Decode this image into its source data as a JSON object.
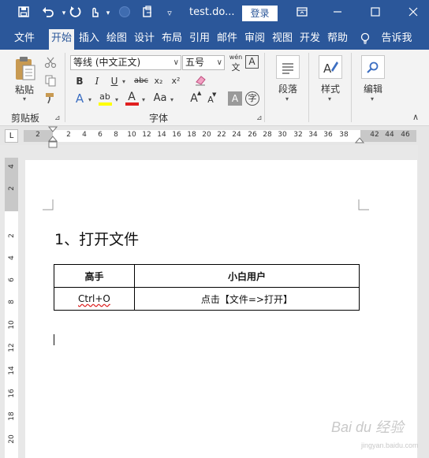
{
  "window": {
    "title": "test.do...",
    "login_label": "登录",
    "quick_access": [
      "save-icon",
      "undo-icon",
      "redo-icon",
      "touch-mode-icon",
      "circle-icon",
      "clipboard-icon",
      "customize-icon"
    ],
    "controls": [
      "ribbon-display-icon",
      "minimize-icon",
      "maximize-icon",
      "close-icon"
    ]
  },
  "tabs": [
    "文件",
    "开始",
    "插入",
    "绘图",
    "设计",
    "布局",
    "引用",
    "邮件",
    "审阅",
    "视图",
    "开发",
    "帮助",
    "告诉我"
  ],
  "active_tab": "开始",
  "ribbon": {
    "clipboard": {
      "paste_label": "粘贴",
      "group_label": "剪贴板"
    },
    "font": {
      "font_name": "等线 (中文正文)",
      "font_size": "五号",
      "phonetic_label": "wén",
      "border_char_label": "A",
      "bold": "B",
      "italic": "I",
      "underline": "U",
      "strike": "abc",
      "subscript": "x₂",
      "superscript": "x²",
      "text_effect": "A",
      "highlight": "ab",
      "font_color": "A",
      "change_case": "Aa",
      "grow_font": "A",
      "shrink_font": "A",
      "char_shading": "A",
      "enclose_char": "字",
      "group_label": "字体"
    },
    "paragraph_label": "段落",
    "styles_label": "样式",
    "editing_label": "编辑"
  },
  "ruler": {
    "tab_selector": "L",
    "h_ticks": [
      "2",
      "2",
      "4",
      "6",
      "8",
      "10",
      "12",
      "14",
      "16",
      "18",
      "20",
      "22",
      "24",
      "26",
      "28",
      "30",
      "32",
      "34",
      "36",
      "38",
      "42",
      "44",
      "46"
    ],
    "v_ticks": [
      "4",
      "2",
      "2",
      "4",
      "6",
      "8",
      "10",
      "12",
      "14",
      "16",
      "18",
      "20"
    ]
  },
  "document": {
    "heading": "1、打开文件",
    "table": {
      "headers": [
        "高手",
        "小白用户"
      ],
      "rows": [
        [
          "Ctrl+O",
          "点击【文件=>打开】"
        ]
      ]
    }
  },
  "watermark": {
    "brand": "Bai du 经验",
    "url": "jingyan.baidu.com"
  },
  "colors": {
    "accent": "#2b579a",
    "ribbon_bg": "#f3f3f3",
    "highlight": "#ffff00",
    "font_color": "#e02020"
  }
}
